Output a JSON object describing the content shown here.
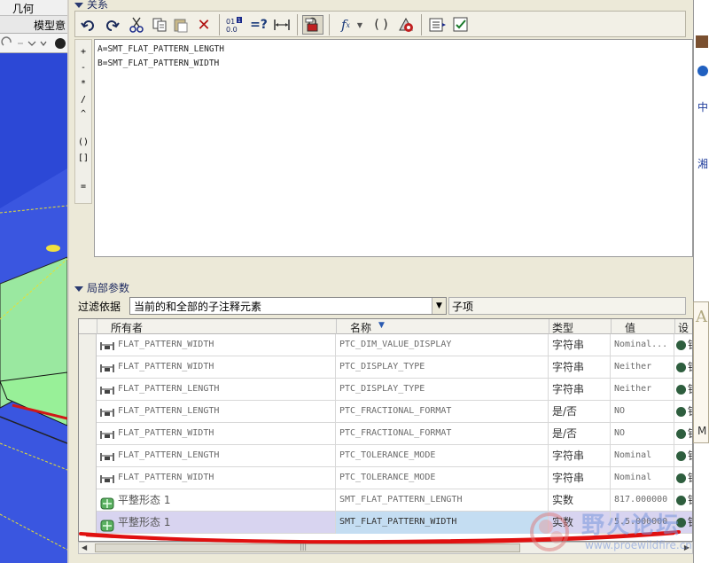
{
  "background_app": {
    "menu_item": "几何",
    "tab_label": "模型意"
  },
  "relations": {
    "section_title": "关系",
    "toolbar_icons": [
      "undo-icon",
      "redo-icon",
      "cut-icon",
      "copy-icon",
      "paste-icon",
      "delete-icon",
      "sort-relations-icon",
      "evaluate-icon",
      "insert-dimension-icon",
      "lock-icon",
      "function-icon",
      "parentheses-icon",
      "parameters-icon",
      "execute-icon",
      "verify-icon"
    ],
    "operators": [
      "+",
      "-",
      "*",
      "/",
      "^",
      "()",
      "[]",
      "="
    ],
    "lines": [
      "A=SMT_FLAT_PATTERN_LENGTH",
      "B=SMT_FLAT_PATTERN_WIDTH"
    ]
  },
  "local_params": {
    "section_title": "局部参数",
    "filter_label": "过滤依据",
    "filter_value": "当前的和全部的子注释元素",
    "child_label": "子项",
    "columns": {
      "owner": "所有者",
      "name": "名称",
      "type": "类型",
      "value": "值",
      "extra": "设"
    },
    "rows": [
      {
        "owner": "FLAT_PATTERN_WIDTH",
        "name": "PTC_DIM_VALUE_DISPLAY",
        "type": "字符串",
        "value": "Nominal...",
        "lock": "锁"
      },
      {
        "owner": "FLAT_PATTERN_WIDTH",
        "name": "PTC_DISPLAY_TYPE",
        "type": "字符串",
        "value": "Neither",
        "lock": "锁"
      },
      {
        "owner": "FLAT_PATTERN_LENGTH",
        "name": "PTC_DISPLAY_TYPE",
        "type": "字符串",
        "value": "Neither",
        "lock": "锁"
      },
      {
        "owner": "FLAT_PATTERN_LENGTH",
        "name": "PTC_FRACTIONAL_FORMAT",
        "type": "是/否",
        "value": "NO",
        "lock": "锁"
      },
      {
        "owner": "FLAT_PATTERN_WIDTH",
        "name": "PTC_FRACTIONAL_FORMAT",
        "type": "是/否",
        "value": "NO",
        "lock": "锁"
      },
      {
        "owner": "FLAT_PATTERN_LENGTH",
        "name": "PTC_TOLERANCE_MODE",
        "type": "字符串",
        "value": "Nominal",
        "lock": "锁定"
      },
      {
        "owner": "FLAT_PATTERN_WIDTH",
        "name": "PTC_TOLERANCE_MODE",
        "type": "字符串",
        "value": "Nominal",
        "lock": "锁定"
      },
      {
        "owner": "平整形态 1",
        "name": "SMT_FLAT_PATTERN_LENGTH",
        "type": "实数",
        "value": "817.000000",
        "lock": "锁定"
      },
      {
        "owner": "平整形态 1",
        "name": "SMT_FLAT_PATTERN_WIDTH",
        "type": "实数",
        "value": "5.5.000000",
        "lock": "锁定"
      }
    ],
    "scroll_marker": "|||"
  },
  "right_window": {
    "chars": [
      "中",
      "湘"
    ],
    "popup_chars": [
      "A",
      "M"
    ]
  },
  "watermark": {
    "title": "野火论坛",
    "url": "www.proewildfire.cn"
  },
  "colors": {
    "annotation_red": "#e01010",
    "selected_row": "#d8d4f0",
    "model_blue": "#2c48d6"
  }
}
